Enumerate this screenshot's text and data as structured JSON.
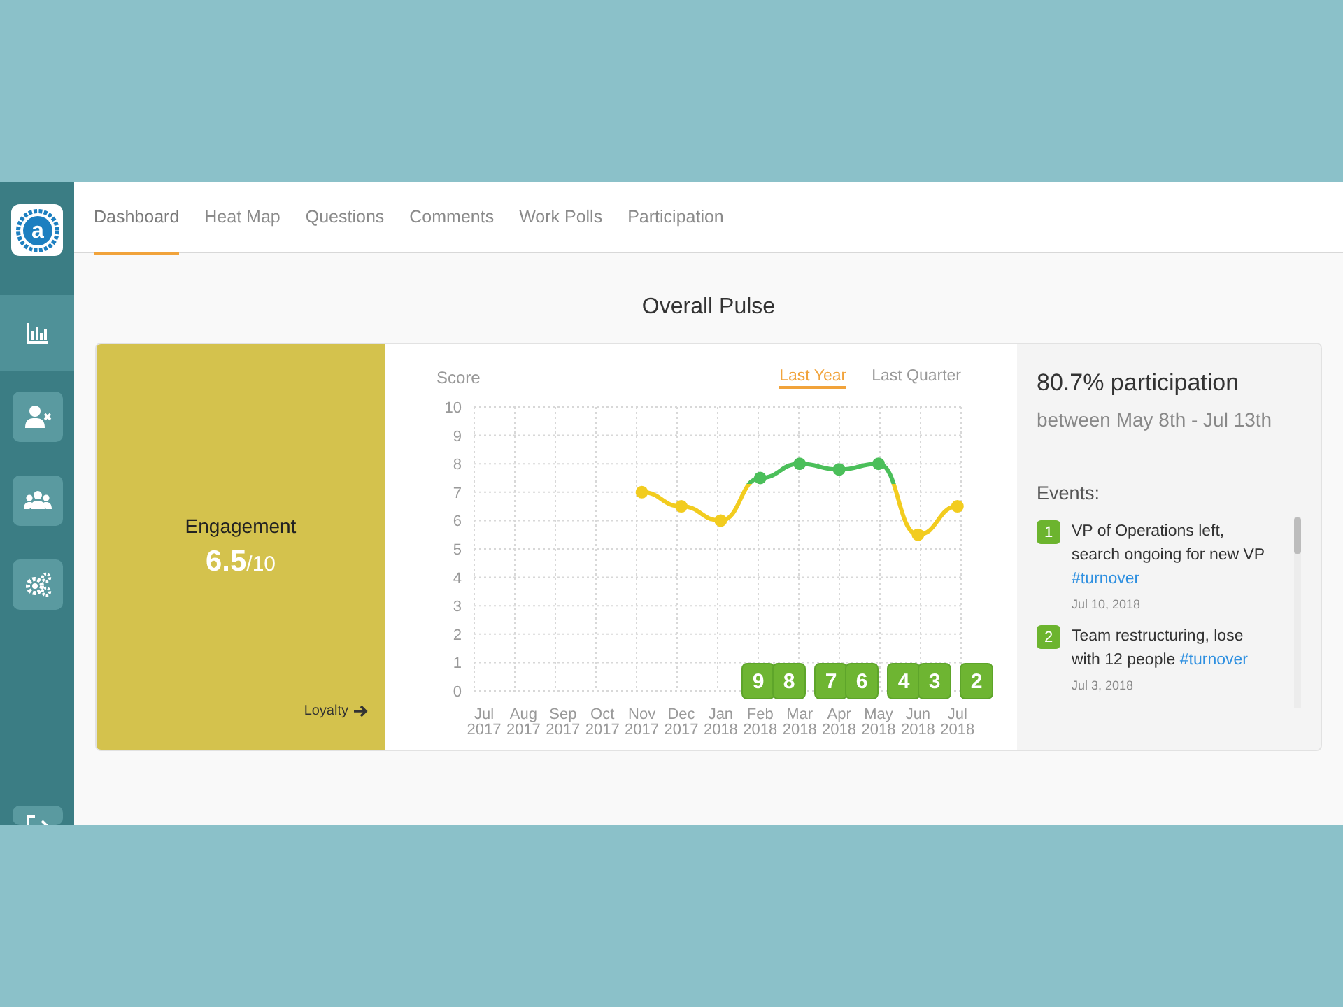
{
  "sidebar": {
    "logo": "a",
    "items": [
      {
        "kind": "chart",
        "selected": true
      },
      {
        "kind": "user",
        "selected": false
      },
      {
        "kind": "team",
        "selected": false
      },
      {
        "kind": "settings",
        "selected": false
      }
    ]
  },
  "tabs": [
    {
      "label": "Dashboard",
      "selected": true
    },
    {
      "label": "Heat Map",
      "selected": false
    },
    {
      "label": "Questions",
      "selected": false
    },
    {
      "label": "Comments",
      "selected": false
    },
    {
      "label": "Work Polls",
      "selected": false
    },
    {
      "label": "Participation",
      "selected": false
    }
  ],
  "title": "Overall Pulse",
  "score": {
    "label": "Engagement",
    "value": "6.5",
    "max": "/10",
    "link": "Loyalty"
  },
  "chart": {
    "ranges": [
      {
        "label": "Last Year",
        "selected": true
      },
      {
        "label": "Last Quarter",
        "selected": false
      }
    ],
    "event_markers": [
      "9",
      "8",
      "7",
      "6",
      "4",
      "3",
      "2"
    ],
    "chart_data": {
      "type": "line",
      "ylabel": "Score",
      "categories": [
        "Jul 2017",
        "Aug 2017",
        "Sep 2017",
        "Oct 2017",
        "Nov 2017",
        "Dec 2017",
        "Jan 2018",
        "Feb 2018",
        "Mar 2018",
        "Apr 2018",
        "May 2018",
        "Jun 2018",
        "Jul 2018"
      ],
      "ylim": [
        0,
        10
      ],
      "yticks": [
        0,
        1,
        2,
        3,
        4,
        5,
        6,
        7,
        8,
        9,
        10
      ],
      "grid": true,
      "series": [
        {
          "color": "#f2cc1f",
          "marker": "circle",
          "values": [
            null,
            null,
            null,
            null,
            7,
            6.5,
            6,
            7.5,
            8,
            7.8,
            8,
            5.5,
            6.5
          ]
        }
      ]
    }
  },
  "participation": {
    "headline": "80.7% participation",
    "period": "between May 8th - Jul 13th",
    "events_label": "Events:",
    "events": [
      {
        "number": "1",
        "text": "VP of Operations left, search ongoing for new VP",
        "tag": "#turnover",
        "date": "Jul 10, 2018"
      },
      {
        "number": "2",
        "text": "Team restructuring, lose with 12 people",
        "tag": "#turnover",
        "date": "Jul 3, 2018"
      }
    ]
  }
}
